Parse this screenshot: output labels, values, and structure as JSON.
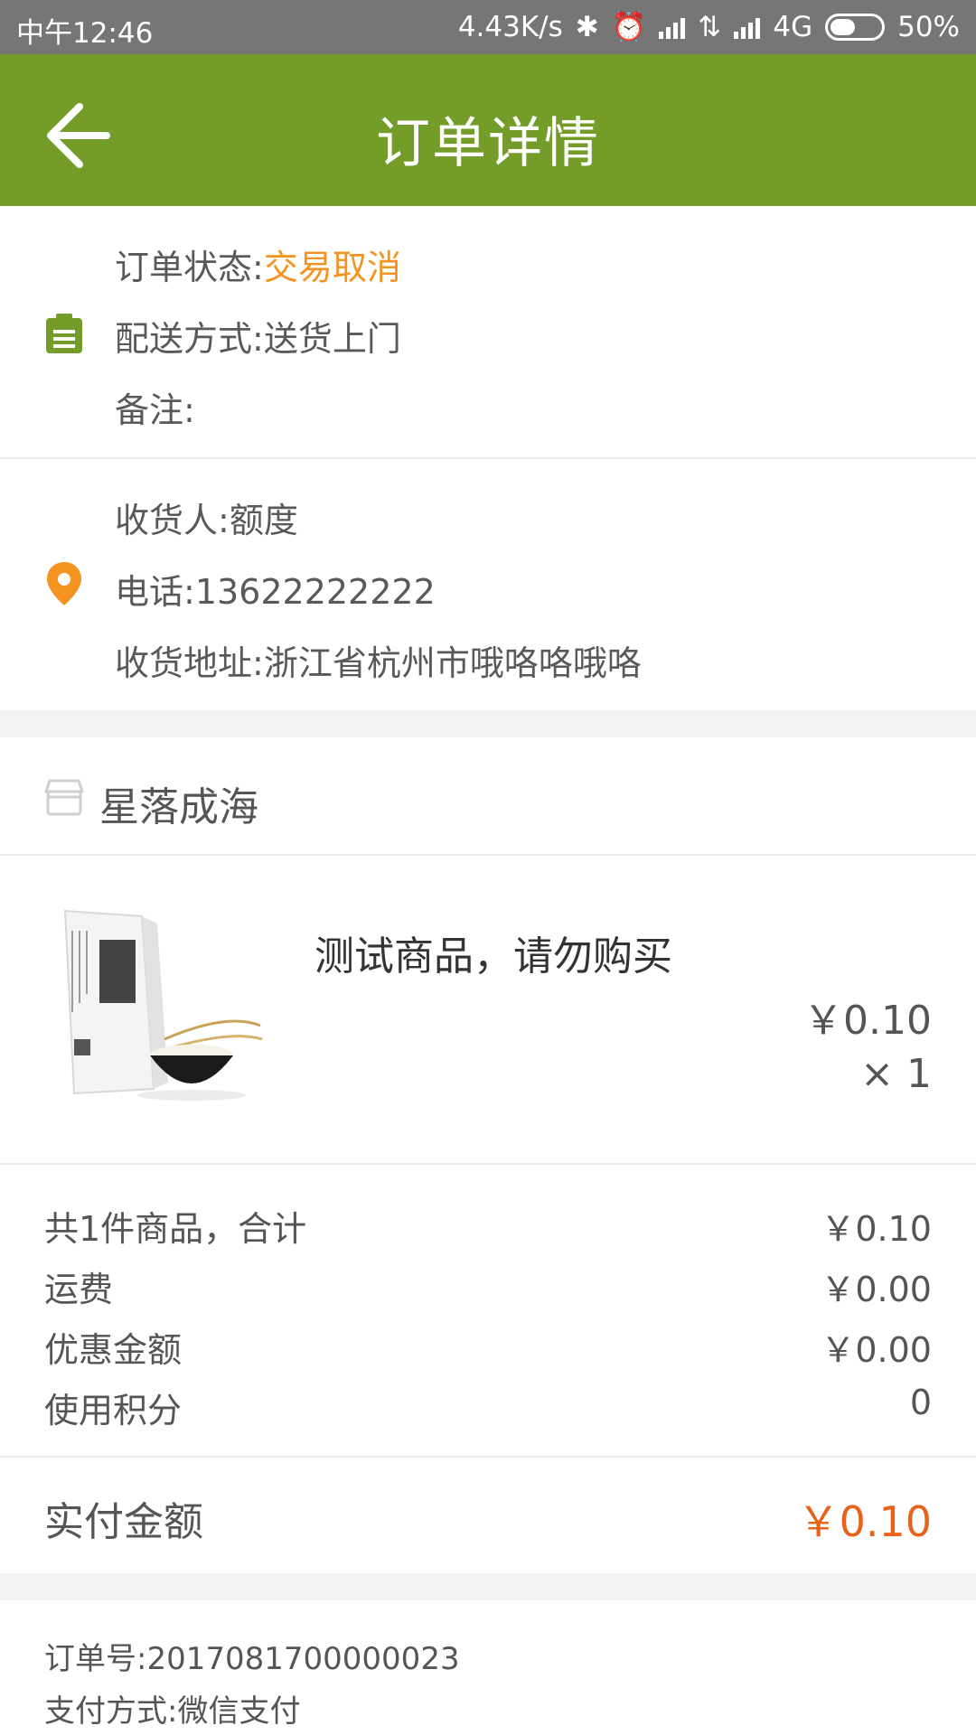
{
  "status_bar": {
    "time": "中午12:46",
    "speed": "4.43K/s",
    "network": "4G",
    "battery": "50%",
    "battery_level": 0.5
  },
  "header": {
    "title": "订单详情"
  },
  "order_info": {
    "status_label": "订单状态:",
    "status_value": "交易取消",
    "delivery_label": "配送方式:",
    "delivery_value": "送货上门",
    "remark_label": "备注:"
  },
  "receiver": {
    "name_label": "收货人:",
    "name_value": "额度",
    "phone_label": "电话:",
    "phone_value": "13622222222",
    "address_label": "收货地址:",
    "address_value": "浙江省杭州市哦咯咯哦咯"
  },
  "store": {
    "name": "星落成海"
  },
  "product": {
    "name": "测试商品，请勿购买",
    "price": "￥0.10",
    "qty": "× 1"
  },
  "summary": [
    {
      "label": "共1件商品，合计",
      "value": "￥0.10"
    },
    {
      "label": "运费",
      "value": "￥0.00"
    },
    {
      "label": "优惠金额",
      "value": "￥0.00"
    },
    {
      "label": "使用积分",
      "value": "0"
    }
  ],
  "payment": {
    "label": "实付金额",
    "value": "￥0.10"
  },
  "order_meta": {
    "order_no_label": "订单号:",
    "order_no": "2017081700000023",
    "pay_method_label": "支付方式:",
    "pay_method": "微信支付"
  },
  "colors": {
    "accent": "#739c29",
    "status": "#f4931f",
    "price": "#e8631a"
  }
}
